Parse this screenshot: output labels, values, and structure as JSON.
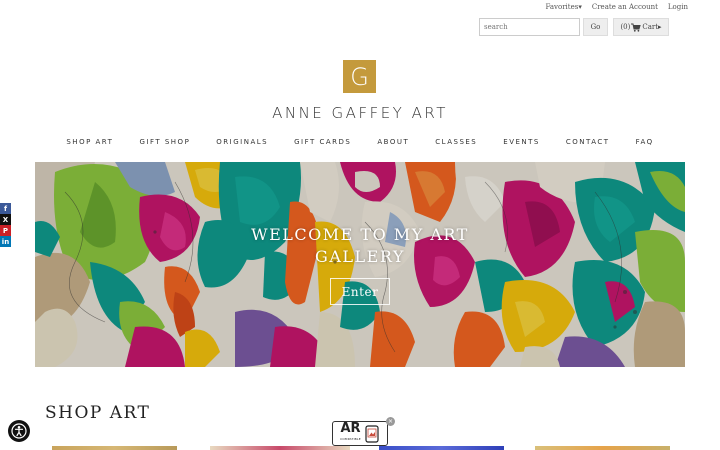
{
  "topbar": {
    "favorites": "Favorites▾",
    "create_account": "Create an Account",
    "login": "Login"
  },
  "search": {
    "placeholder": "search",
    "go_label": "Go",
    "cart_count": "(0)",
    "cart_label": "Cart▸"
  },
  "logo": {
    "letter": "G",
    "title": "ANNE GAFFEY ART",
    "color": "#c49a3c"
  },
  "nav": {
    "items": [
      "SHOP ART",
      "GIFT SHOP",
      "ORIGINALS",
      "GIFT CARDS",
      "ABOUT",
      "CLASSES",
      "EVENTS",
      "CONTACT",
      "FAQ"
    ]
  },
  "social": {
    "icons": [
      "facebook-icon",
      "x-icon",
      "pinterest-icon",
      "linkedin-icon"
    ],
    "glyphs": [
      "f",
      "X",
      "P",
      "in"
    ],
    "colors": [
      "#3b5998",
      "#111111",
      "#cb2027",
      "#0077b5"
    ]
  },
  "hero": {
    "line1": "WELCOME TO MY ART",
    "line2": "GALLERY",
    "button": "Enter"
  },
  "section": {
    "title": "SHOP ART"
  },
  "ar_badge": {
    "label": "AR",
    "sub": "COMPATIBLE",
    "close": "×"
  }
}
